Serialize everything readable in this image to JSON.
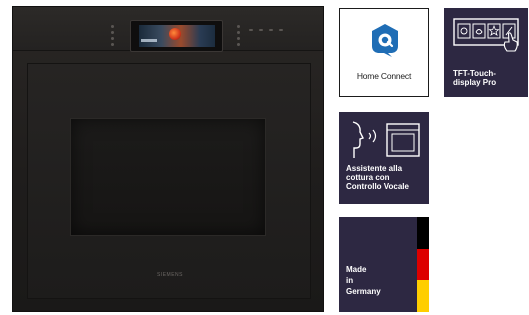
{
  "oven": {
    "brand": "SIEMENS"
  },
  "badges": {
    "home_connect": {
      "label": "Home Connect",
      "icon": "home-connect-icon"
    },
    "tft_touch": {
      "label_line1": "TFT-Touch-",
      "label_line2": "display Pro",
      "icon": "tft-touch-display-icon"
    },
    "voice": {
      "label_line1": "Assistente alla",
      "label_line2": "cottura con",
      "label_line3": "Controllo Vocale",
      "icon": "voice-control-icon"
    },
    "germany": {
      "label_line1": "Made",
      "label_line2": "in",
      "label_line3": "Germany",
      "icon": "germany-flag-icon"
    }
  },
  "colors": {
    "badge_background": "#2d2842",
    "home_connect_blue": "#1f6db5",
    "oven_body": "#1f1d1c",
    "flag_black": "#000000",
    "flag_red": "#dd0000",
    "flag_gold": "#ffce00"
  }
}
